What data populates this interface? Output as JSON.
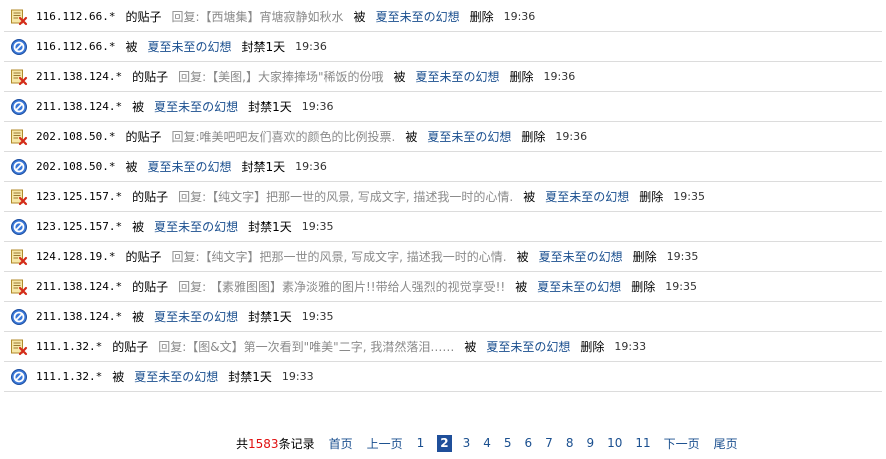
{
  "rows": [
    {
      "type": "post-delete",
      "ip": "116.112.66.*",
      "of": "的贴子",
      "content": "回复:【西塘集】宵塘寂静如秋水",
      "by": "被",
      "user": "夏至未至の幻想",
      "action": "删除",
      "time": "19:36"
    },
    {
      "type": "ban",
      "ip": "116.112.66.*",
      "by": "被",
      "user": "夏至未至の幻想",
      "action": "封禁1天",
      "time": "19:36"
    },
    {
      "type": "post-delete",
      "ip": "211.138.124.*",
      "of": "的贴子",
      "content": "回复:【美图,】大家捧捧场\"稀饭的份哦",
      "by": "被",
      "user": "夏至未至の幻想",
      "action": "删除",
      "time": "19:36"
    },
    {
      "type": "ban",
      "ip": "211.138.124.*",
      "by": "被",
      "user": "夏至未至の幻想",
      "action": "封禁1天",
      "time": "19:36"
    },
    {
      "type": "post-delete",
      "ip": "202.108.50.*",
      "of": "的贴子",
      "content": "回复:唯美吧吧友们喜欢的颜色的比例投票.",
      "by": "被",
      "user": "夏至未至の幻想",
      "action": "删除",
      "time": "19:36"
    },
    {
      "type": "ban",
      "ip": "202.108.50.*",
      "by": "被",
      "user": "夏至未至の幻想",
      "action": "封禁1天",
      "time": "19:36"
    },
    {
      "type": "post-delete",
      "ip": "123.125.157.*",
      "of": "的贴子",
      "content": "回复:【纯文字】把那一世的风景, 写成文字, 描述我一时的心情.",
      "by": "被",
      "user": "夏至未至の幻想",
      "action": "删除",
      "time": "19:35"
    },
    {
      "type": "ban",
      "ip": "123.125.157.*",
      "by": "被",
      "user": "夏至未至の幻想",
      "action": "封禁1天",
      "time": "19:35"
    },
    {
      "type": "post-delete",
      "ip": "124.128.19.*",
      "of": "的贴子",
      "content": "回复:【纯文字】把那一世的风景, 写成文字, 描述我一时的心情.",
      "by": "被",
      "user": "夏至未至の幻想",
      "action": "删除",
      "time": "19:35"
    },
    {
      "type": "post-delete",
      "ip": "211.138.124.*",
      "of": "的贴子",
      "content": "回复: 【素雅图图】素净淡雅的图片!!带给人强烈的视觉享受!!",
      "by": "被",
      "user": "夏至未至の幻想",
      "action": "删除",
      "time": "19:35"
    },
    {
      "type": "ban",
      "ip": "211.138.124.*",
      "by": "被",
      "user": "夏至未至の幻想",
      "action": "封禁1天",
      "time": "19:35"
    },
    {
      "type": "post-delete",
      "ip": "111.1.32.*",
      "of": "的贴子",
      "content": "回复:【图&文】第一次看到\"唯美\"二字, 我潸然落泪……",
      "by": "被",
      "user": "夏至未至の幻想",
      "action": "删除",
      "time": "19:33"
    },
    {
      "type": "ban",
      "ip": "111.1.32.*",
      "by": "被",
      "user": "夏至未至の幻想",
      "action": "封禁1天",
      "time": "19:33"
    }
  ],
  "pager": {
    "total_prefix": "共",
    "total_count": "1583",
    "total_suffix": "条记录",
    "first": "首页",
    "prev": "上一页",
    "pages": [
      "1",
      "2",
      "3",
      "4",
      "5",
      "6",
      "7",
      "8",
      "9",
      "10",
      "11"
    ],
    "current": "2",
    "next": "下一页",
    "last": "尾页"
  },
  "icons": {
    "post-delete": "delete-post-icon",
    "ban": "ban-icon"
  },
  "colors": {
    "link": "#1a4f8f",
    "content": "#8a8a8a",
    "count": "#e01010",
    "current_page_bg": "#1f4f9a"
  }
}
